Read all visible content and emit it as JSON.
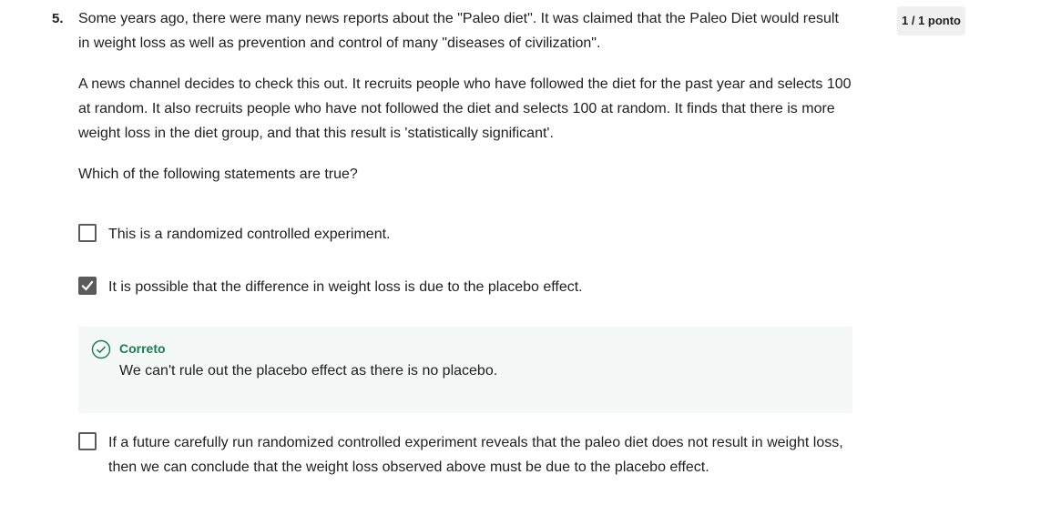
{
  "question": {
    "number": "5.",
    "score": "1 / 1 ponto",
    "paragraphs": [
      "Some years ago, there were many news reports about the \"Paleo diet\". It was claimed that the Paleo Diet would result in weight loss as well as prevention and control of many \"diseases of civilization\".",
      "A news channel decides to check this out. It recruits people who have followed the diet for the past year and selects 100 at random. It also recruits people who have not followed the diet and selects 100 at random. It finds that there is more weight loss in the diet group, and that this result is 'statistically significant'.",
      "Which of the following statements are true?"
    ],
    "options": [
      {
        "label": "This is a randomized controlled experiment.",
        "checked": false
      },
      {
        "label": "It is possible that the difference in weight loss is due to the placebo effect.",
        "checked": true
      },
      {
        "label": "If a future carefully run randomized controlled experiment reveals that the paleo diet does not result in weight loss, then we can conclude that the weight loss observed above must be due to the placebo effect.",
        "checked": false
      }
    ],
    "feedback": {
      "status": "Correto",
      "text": "We can't rule out the placebo effect as there is no placebo.",
      "icon": "check-circle-icon"
    }
  },
  "colors": {
    "correct": "#1d7c50",
    "feedback_bg": "#f4f8f6",
    "checkbox": "#5b5b5b"
  }
}
